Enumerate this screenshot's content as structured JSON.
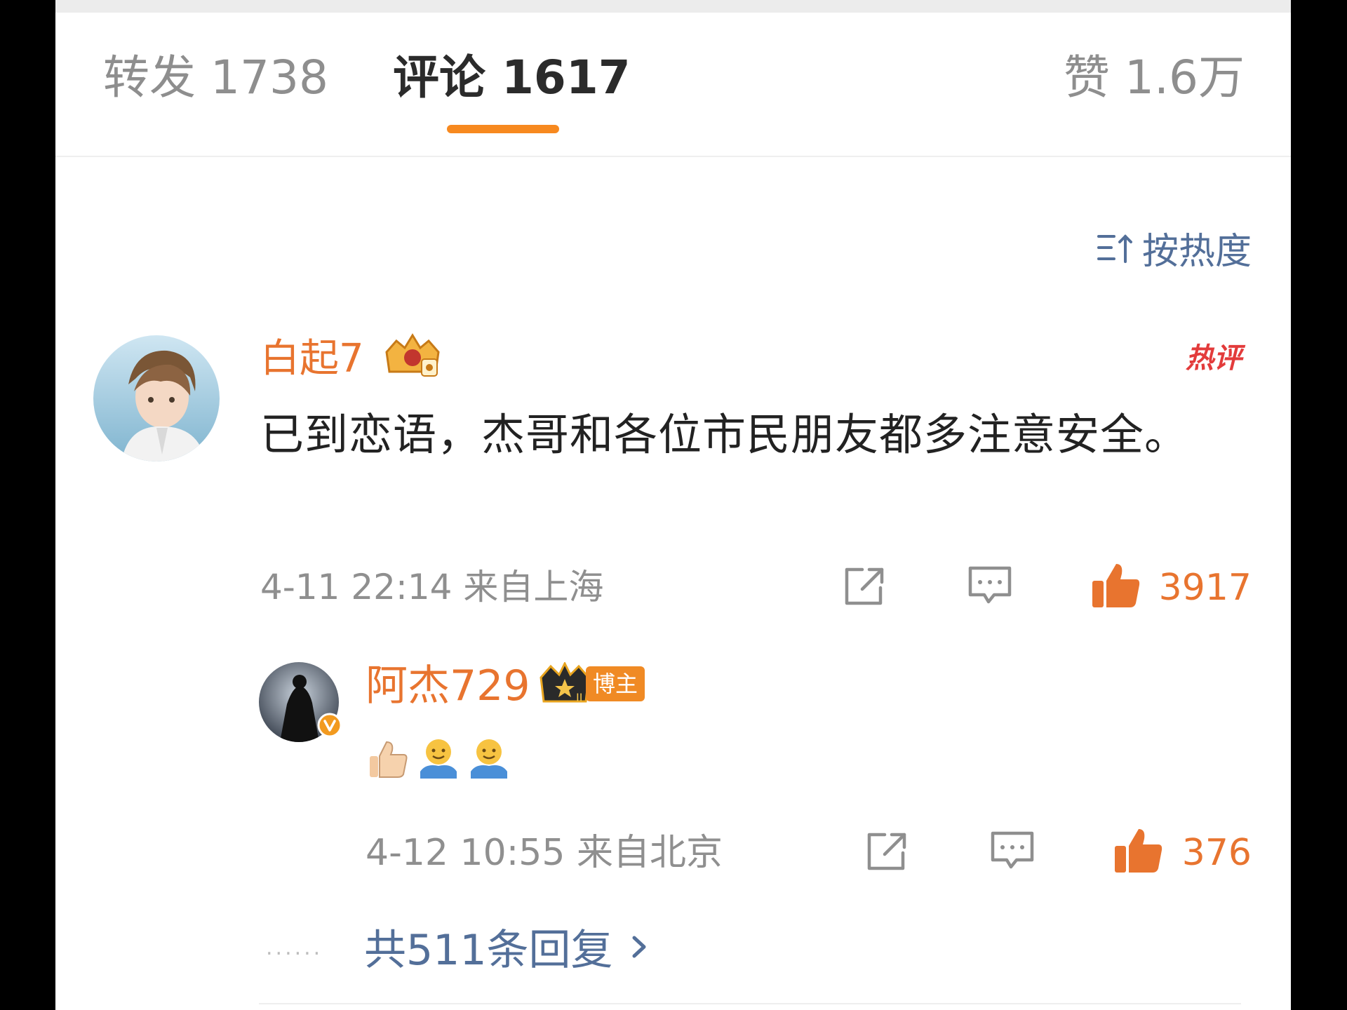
{
  "tabs": {
    "repost": "转发 1738",
    "comments": "评论 1617",
    "likes": "赞 1.6万"
  },
  "sort": {
    "label": "按热度",
    "icon": "sort-icon"
  },
  "comment": {
    "username": "白起7",
    "hot_tag": "热评",
    "text": "已到恋语，杰哥和各位市民朋友都多注意安全。",
    "time": "4-11 22:14",
    "location": "来自上海",
    "likes": "3917"
  },
  "reply": {
    "username": "阿杰729",
    "badge": "博主",
    "emoji": [
      "thumbs-up",
      "hug",
      "hug"
    ],
    "time": "4-12 10:55",
    "location": "来自北京",
    "likes": "376"
  },
  "more_replies": {
    "label": "共511条回复",
    "dots": "......"
  },
  "colors": {
    "accent": "#e8742f",
    "link": "#536f99",
    "underline": "#f7891f",
    "hot": "#e33b3b"
  }
}
